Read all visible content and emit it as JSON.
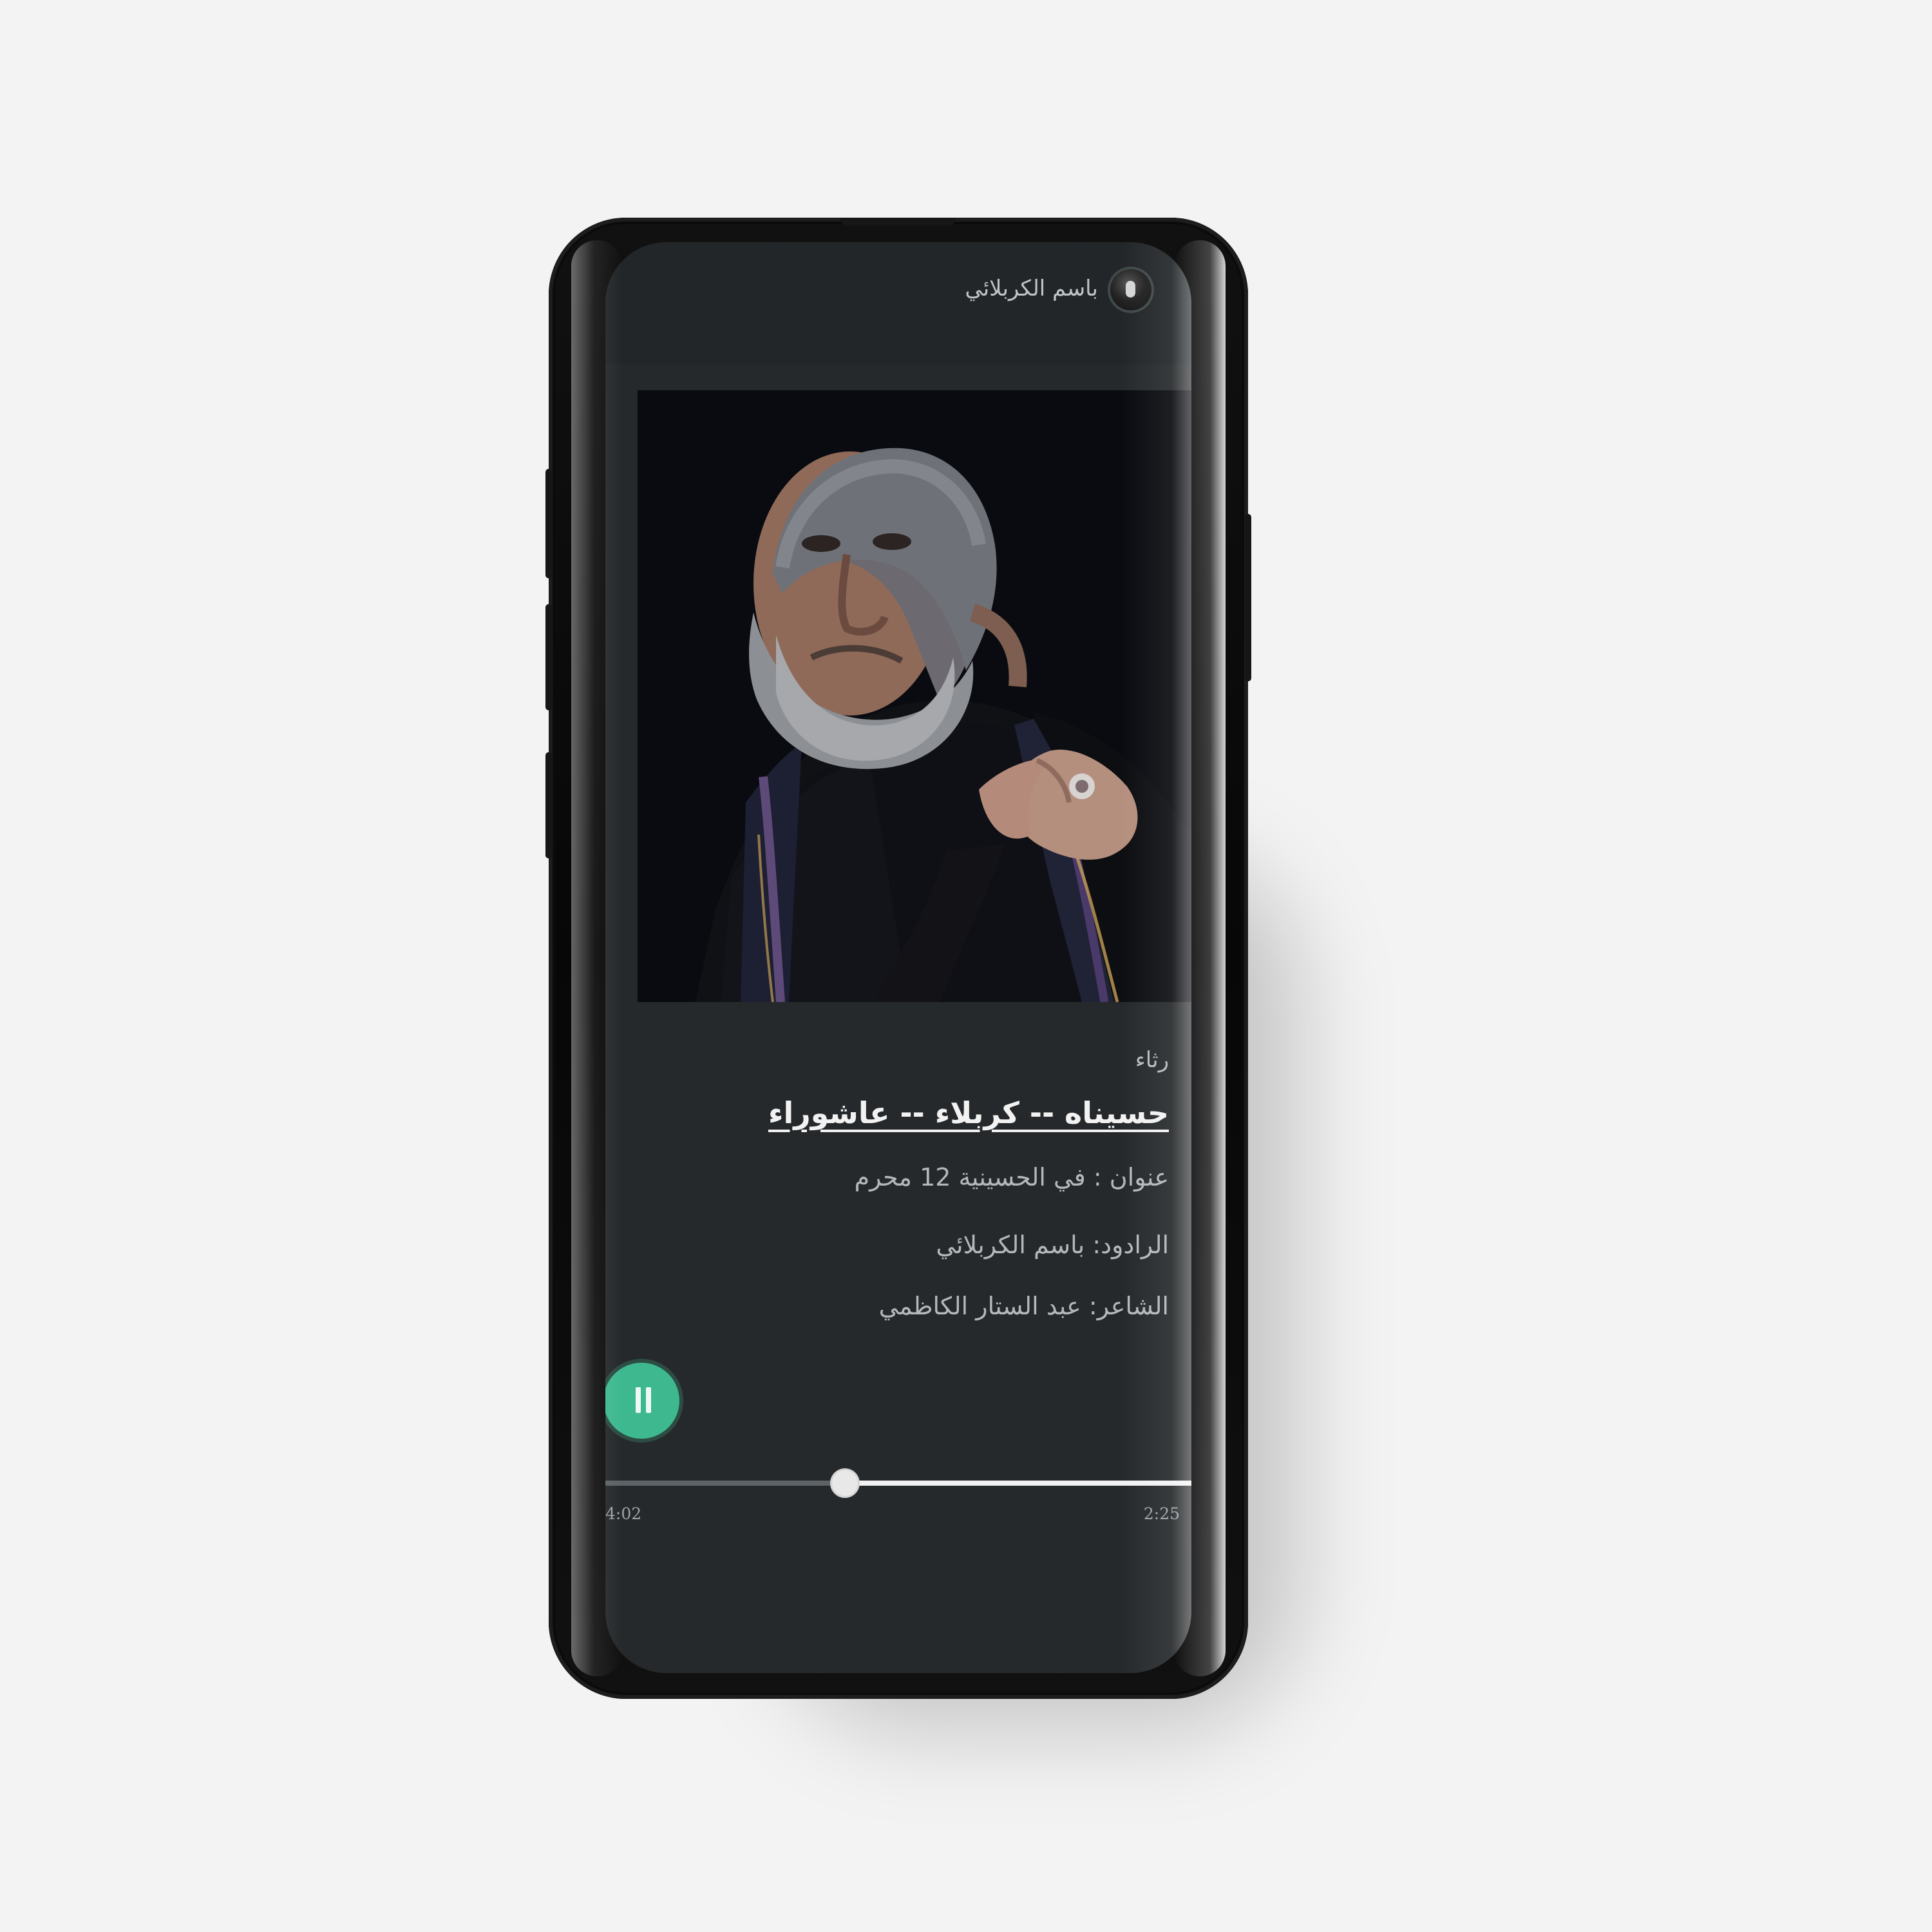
{
  "app": {
    "reciter_name": "باسم الكربلائي",
    "avatar_icon": "reciter-avatar-icon"
  },
  "track": {
    "category": "رثاء",
    "title": "حسيناه -- كربلاء -- عاشوراء",
    "address": "عنوان : في الحسينية 12 محرم",
    "reciter": "الرادود: باسم الكربلائي",
    "poet": "الشاعر: عبد الستار الكاظمي"
  },
  "player": {
    "state_icon": "pause-icon",
    "total_time": "4:02",
    "elapsed_time": "2:25",
    "progress_fraction": 0.6,
    "accent_color": "#3eb98f"
  }
}
